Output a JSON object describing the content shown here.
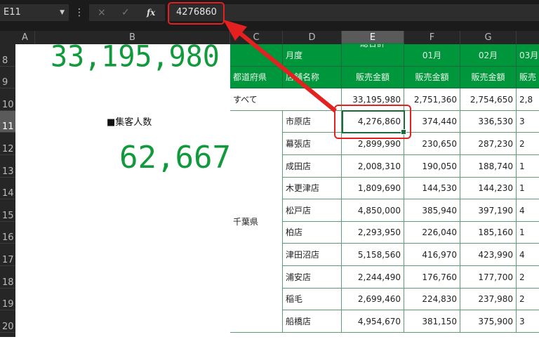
{
  "formula_bar": {
    "name_box": "E11",
    "formula": "4276860",
    "cancel_icon": "×",
    "enter_icon": "✓",
    "fx_label": "fx"
  },
  "columns": [
    "A",
    "B",
    "C",
    "D",
    "E",
    "F",
    "G",
    ""
  ],
  "rows": [
    "8",
    "9",
    "10",
    "11",
    "12",
    "13",
    "14",
    "15",
    "16",
    "17",
    "18",
    "19",
    "20"
  ],
  "selected_cell": "E11",
  "summary": {
    "total_sales": "33,195,980",
    "visitors_label": "■集客人数",
    "visitors": "62,667"
  },
  "table": {
    "header1": {
      "month_label": "月度",
      "total_label": "総合計",
      "months": [
        "01月",
        "02月",
        "03月"
      ]
    },
    "header2": {
      "pref_label": "都道府県",
      "store_label": "店舗名称",
      "sales_label": "販売金額",
      "h_sales_label": "販売"
    },
    "all_row": {
      "label": "すべて",
      "total": "33,195,980",
      "m1": "2,751,360",
      "m2": "2,754,650",
      "m3": "2,8"
    },
    "prefecture": "千葉県",
    "stores": [
      {
        "name": "市原店",
        "total": "4,276,860",
        "m1": "374,440",
        "m2": "336,530",
        "m3": "3"
      },
      {
        "name": "幕張店",
        "total": "2,899,990",
        "m1": "230,650",
        "m2": "287,230",
        "m3": "2"
      },
      {
        "name": "成田店",
        "total": "2,008,310",
        "m1": "190,050",
        "m2": "188,740",
        "m3": "1"
      },
      {
        "name": "木更津店",
        "total": "1,809,690",
        "m1": "144,530",
        "m2": "144,230",
        "m3": "1"
      },
      {
        "name": "松戸店",
        "total": "4,850,000",
        "m1": "385,940",
        "m2": "397,190",
        "m3": "4"
      },
      {
        "name": "柏店",
        "total": "2,293,950",
        "m1": "226,040",
        "m2": "185,160",
        "m3": "1"
      },
      {
        "name": "津田沼店",
        "total": "5,158,560",
        "m1": "416,970",
        "m2": "423,990",
        "m3": "4"
      },
      {
        "name": "浦安店",
        "total": "2,244,490",
        "m1": "176,760",
        "m2": "177,700",
        "m3": "2"
      },
      {
        "name": "稲毛",
        "total": "2,699,460",
        "m1": "224,830",
        "m2": "237,980",
        "m3": "2"
      },
      {
        "name": "船橋店",
        "total": "4,954,670",
        "m1": "381,150",
        "m2": "375,900",
        "m3": "3"
      }
    ]
  },
  "colors": {
    "header_green": "#00963c",
    "big_number_green": "#109a3c",
    "highlight_red": "#e52020"
  }
}
